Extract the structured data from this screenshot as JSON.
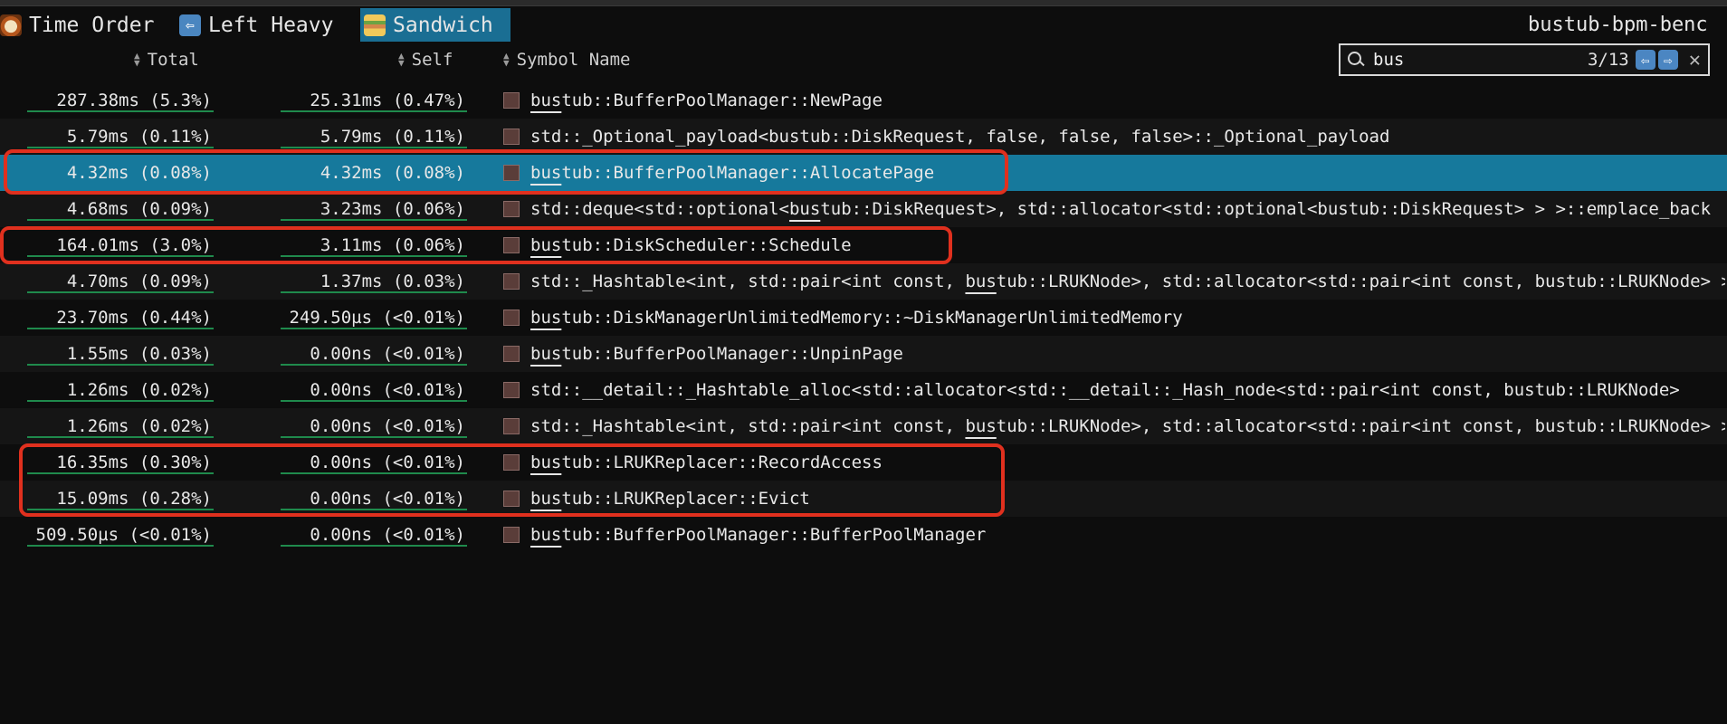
{
  "tabs": [
    {
      "label": "Time Order",
      "icon": "clock-icon"
    },
    {
      "label": "Left Heavy",
      "icon": "arrow-left-icon"
    },
    {
      "label": "Sandwich",
      "icon": "sandwich-icon"
    }
  ],
  "app_title": "bustub-bpm-benc",
  "columns": {
    "total": "Total",
    "self": "Self",
    "symbol": "Symbol Name"
  },
  "search": {
    "value": "bus",
    "match_count": "3/13"
  },
  "rows": [
    {
      "total": "287.38ms (5.3%)",
      "self": "25.31ms (0.47%)",
      "symbol_hl": "bus",
      "symbol_rest": "tub::BufferPoolManager::NewPage",
      "symbol_pre": ""
    },
    {
      "total": "5.79ms (0.11%)",
      "self": "5.79ms (0.11%)",
      "symbol_pre": "std::_Optional_payload<bustub::DiskRequest, false, false, false>::_Optional_payload",
      "symbol_hl": "",
      "symbol_rest": ""
    },
    {
      "total": "4.32ms (0.08%)",
      "self": "4.32ms (0.08%)",
      "symbol_pre": "",
      "symbol_hl": "bus",
      "symbol_rest": "tub::BufferPoolManager::AllocatePage"
    },
    {
      "total": "4.68ms (0.09%)",
      "self": "3.23ms (0.06%)",
      "symbol_pre": "std::deque<std::optional<",
      "symbol_hl": "bus",
      "symbol_rest": "tub::DiskRequest>, std::allocator<std::optional<bustub::DiskRequest> > >::emplace_back"
    },
    {
      "total": "164.01ms (3.0%)",
      "self": "3.11ms (0.06%)",
      "symbol_pre": "",
      "symbol_hl": "bus",
      "symbol_rest": "tub::DiskScheduler::Schedule"
    },
    {
      "total": "4.70ms (0.09%)",
      "self": "1.37ms (0.03%)",
      "symbol_pre": "std::_Hashtable<int, std::pair<int const, ",
      "symbol_hl": "bus",
      "symbol_rest": "tub::LRUKNode>, std::allocator<std::pair<int const, bustub::LRUKNode> >"
    },
    {
      "total": "23.70ms (0.44%)",
      "self": "249.50µs (<0.01%)",
      "symbol_pre": "",
      "symbol_hl": "bus",
      "symbol_rest": "tub::DiskManagerUnlimitedMemory::~DiskManagerUnlimitedMemory"
    },
    {
      "total": "1.55ms (0.03%)",
      "self": "0.00ns (<0.01%)",
      "symbol_pre": "",
      "symbol_hl": "bus",
      "symbol_rest": "tub::BufferPoolManager::UnpinPage"
    },
    {
      "total": "1.26ms (0.02%)",
      "self": "0.00ns (<0.01%)",
      "symbol_pre": "std::__detail::_Hashtable_alloc<std::allocator<std::__detail::_Hash_node<std::pair<int const, bustub::LRUKNode>",
      "symbol_hl": "",
      "symbol_rest": ""
    },
    {
      "total": "1.26ms (0.02%)",
      "self": "0.00ns (<0.01%)",
      "symbol_pre": "std::_Hashtable<int, std::pair<int const, ",
      "symbol_hl": "bus",
      "symbol_rest": "tub::LRUKNode>, std::allocator<std::pair<int const, bustub::LRUKNode> >"
    },
    {
      "total": "16.35ms (0.30%)",
      "self": "0.00ns (<0.01%)",
      "symbol_pre": "",
      "symbol_hl": "bus",
      "symbol_rest": "tub::LRUKReplacer::RecordAccess"
    },
    {
      "total": "15.09ms (0.28%)",
      "self": "0.00ns (<0.01%)",
      "symbol_pre": "",
      "symbol_hl": "bus",
      "symbol_rest": "tub::LRUKReplacer::Evict"
    },
    {
      "total": "509.50µs (<0.01%)",
      "self": "0.00ns (<0.01%)",
      "symbol_pre": "",
      "symbol_hl": "bus",
      "symbol_rest": "tub::BufferPoolManager::BufferPoolManager"
    }
  ],
  "selected_row": 2,
  "colors": {
    "selected": "#16799c",
    "accent_tab": "#1a6e93",
    "annotation": "#e0301e"
  }
}
